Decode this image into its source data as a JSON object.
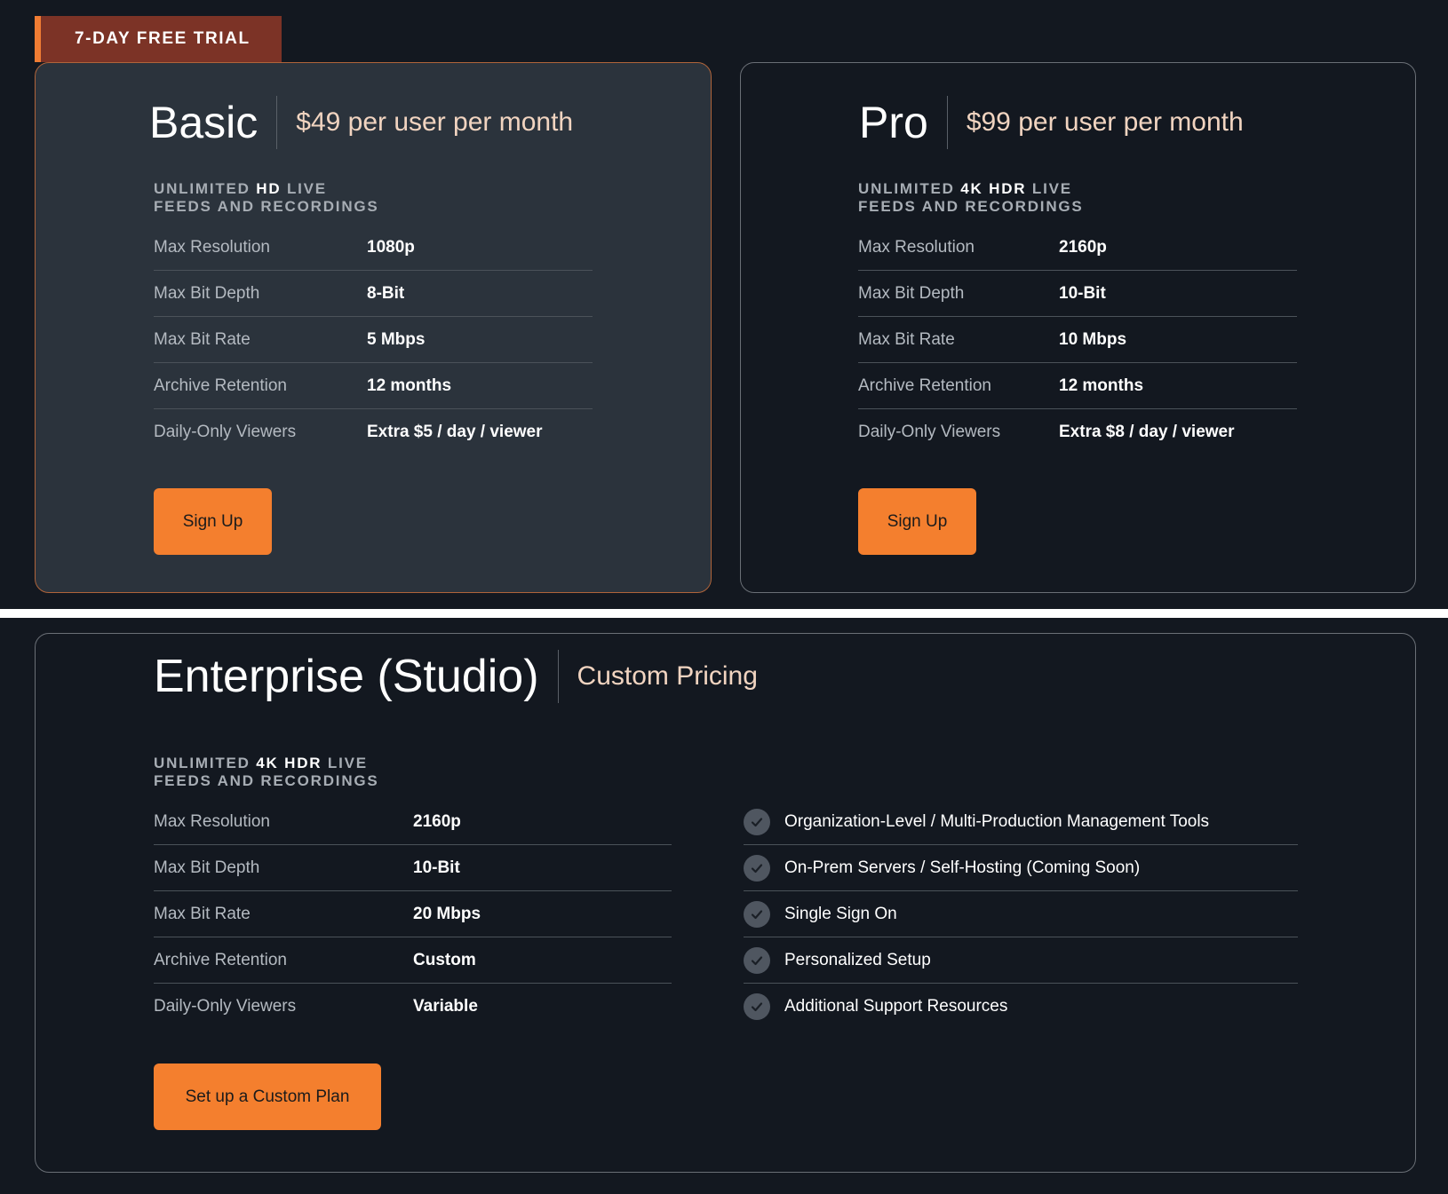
{
  "trial_badge": "7-DAY FREE TRIAL",
  "basic": {
    "name": "Basic",
    "price": "$49 per user per month",
    "feeds": {
      "prefix": "UNLIMITED ",
      "highlight": "HD",
      "suffix": " LIVE",
      "line2": "FEEDS AND RECORDINGS"
    },
    "specs": [
      {
        "label": "Max Resolution",
        "value": "1080p"
      },
      {
        "label": "Max Bit Depth",
        "value": "8-Bit"
      },
      {
        "label": "Max Bit Rate",
        "value": "5 Mbps"
      },
      {
        "label": "Archive Retention",
        "value": "12 months"
      },
      {
        "label": "Daily-Only Viewers",
        "value": "Extra $5 / day / viewer"
      }
    ],
    "button": "Sign Up"
  },
  "pro": {
    "name": "Pro",
    "price": "$99 per user per month",
    "feeds": {
      "prefix": "UNLIMITED ",
      "highlight": "4K HDR",
      "suffix": " LIVE",
      "line2": "FEEDS AND RECORDINGS"
    },
    "specs": [
      {
        "label": "Max Resolution",
        "value": "2160p"
      },
      {
        "label": "Max Bit Depth",
        "value": "10-Bit"
      },
      {
        "label": "Max Bit Rate",
        "value": "10 Mbps"
      },
      {
        "label": "Archive Retention",
        "value": "12 months"
      },
      {
        "label": "Daily-Only Viewers",
        "value": "Extra $8 / day / viewer"
      }
    ],
    "button": "Sign Up"
  },
  "enterprise": {
    "name": "Enterprise (Studio)",
    "price": "Custom Pricing",
    "feeds": {
      "prefix": "UNLIMITED ",
      "highlight": "4K HDR",
      "suffix": " LIVE",
      "line2": "FEEDS AND RECORDINGS"
    },
    "specs": [
      {
        "label": "Max Resolution",
        "value": "2160p"
      },
      {
        "label": "Max Bit Depth",
        "value": "10-Bit"
      },
      {
        "label": "Max Bit Rate",
        "value": "20 Mbps"
      },
      {
        "label": "Archive Retention",
        "value": "Custom"
      },
      {
        "label": "Daily-Only Viewers",
        "value": "Variable"
      }
    ],
    "features": [
      "Organization-Level / Multi-Production Management Tools",
      "On-Prem Servers / Self-Hosting (Coming Soon)",
      "Single Sign On",
      "Personalized Setup",
      "Additional Support Resources"
    ],
    "button": "Set up a Custom Plan"
  },
  "colors": {
    "background": "#131820",
    "basic_card": "#2b333c",
    "accent": "#f47f2e",
    "ribbon": "#7c3326",
    "price_text": "#f1d4c0"
  }
}
